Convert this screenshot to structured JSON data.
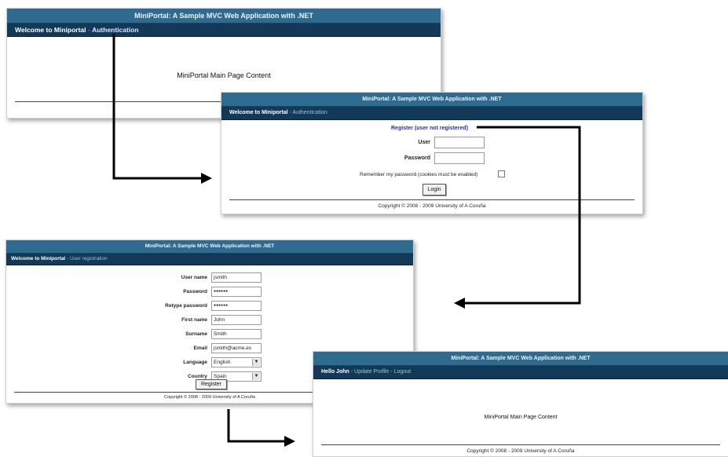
{
  "app_title": "MiniPortal: A Sample MVC Web Application with .NET",
  "footer_text": "Copyright © 2008 - 2009 University of A Coruña",
  "window_main": {
    "title": "MiniPortal: A Sample MVC Web Application with .NET",
    "nav_welcome": "Welcome to Miniportal",
    "nav_separator": " - ",
    "nav_link": "Authentication",
    "content": "MiniPortal Main Page Content",
    "footer_visible": "Copyright © 2008   20"
  },
  "window_auth": {
    "title": "MiniPortal: A Sample MVC Web Application with .NET",
    "nav_welcome": "Welcome to Miniportal",
    "nav_sub": " - Authentication",
    "register_link": "Register (user not registered)",
    "user_label": "User",
    "password_label": "Password",
    "remember_label": "Remember my password (cookies must be enabled)",
    "login_button": "Login",
    "footer": "Copyright © 2008 - 2009 University of A Coruña"
  },
  "window_register": {
    "title": "MiniPortal: A Sample MVC Web Application with .NET",
    "nav_welcome": "Welcome to Miniportal",
    "nav_sub": " - User registration",
    "fields": {
      "user_name": {
        "label": "User name",
        "value": "jsmith"
      },
      "password": {
        "label": "Password",
        "value": "●●●●●●"
      },
      "retype_password": {
        "label": "Retype password",
        "value": "●●●●●●"
      },
      "first_name": {
        "label": "First name",
        "value": "John"
      },
      "surname": {
        "label": "Surname",
        "value": "Smith"
      },
      "email": {
        "label": "Email",
        "value": "jsmith@acme.es"
      },
      "language": {
        "label": "Language",
        "value": "English"
      },
      "country": {
        "label": "Country",
        "value": "Spain"
      }
    },
    "register_button": "Register",
    "footer": "Copyright © 2008 - 2009 University of A Coruña"
  },
  "window_home": {
    "title": "MiniPortal: A Sample MVC Web Application with .NET",
    "nav_hello": "Hello John",
    "nav_sep1": " - ",
    "nav_update": "Update Profile",
    "nav_sep2": " - ",
    "nav_logout": "Logout",
    "content": "MiniPortal Main Page Content",
    "footer": "Copyright © 2008 - 2009 University of A Coruña"
  },
  "colors": {
    "title_bar": "#2f6b8f",
    "nav_bar": "#123a58",
    "arrow": "#000000",
    "link": "#2233aa"
  }
}
